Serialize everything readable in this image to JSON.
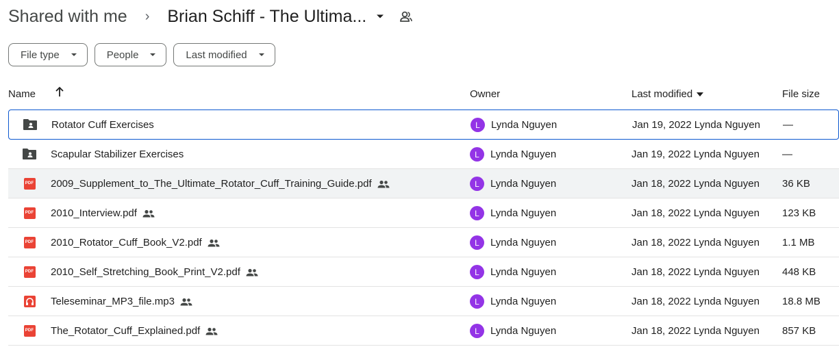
{
  "breadcrumb": {
    "root": "Shared with me",
    "separator": "›",
    "current": "Brian Schiff - The Ultima..."
  },
  "filters": [
    {
      "label": "File type"
    },
    {
      "label": "People"
    },
    {
      "label": "Last modified"
    }
  ],
  "columns": {
    "name": "Name",
    "owner": "Owner",
    "last_modified": "Last modified",
    "file_size": "File size"
  },
  "colors": {
    "accent": "#0b57d0",
    "avatar": "#9334e6",
    "pdf": "#ea4335",
    "audio": "#ea4335",
    "folder": "#444746"
  },
  "files": [
    {
      "icon": "shared-folder-icon",
      "name": "Rotator Cuff Exercises",
      "shared": false,
      "owner_initial": "L",
      "owner": "Lynda Nguyen",
      "modified_date": "Jan 19, 2022",
      "modified_by": "Lynda Nguyen",
      "size": "—"
    },
    {
      "icon": "shared-folder-icon",
      "name": "Scapular Stabilizer Exercises",
      "shared": false,
      "owner_initial": "L",
      "owner": "Lynda Nguyen",
      "modified_date": "Jan 19, 2022",
      "modified_by": "Lynda Nguyen",
      "size": "—"
    },
    {
      "icon": "pdf-icon",
      "pdf_label": "PDF",
      "name": "2009_Supplement_to_The_Ultimate_Rotator_Cuff_Training_Guide.pdf",
      "shared": true,
      "owner_initial": "L",
      "owner": "Lynda Nguyen",
      "modified_date": "Jan 18, 2022",
      "modified_by": "Lynda Nguyen",
      "size": "36 KB"
    },
    {
      "icon": "pdf-icon",
      "pdf_label": "PDF",
      "name": "2010_Interview.pdf",
      "shared": true,
      "owner_initial": "L",
      "owner": "Lynda Nguyen",
      "modified_date": "Jan 18, 2022",
      "modified_by": "Lynda Nguyen",
      "size": "123 KB"
    },
    {
      "icon": "pdf-icon",
      "pdf_label": "PDF",
      "name": "2010_Rotator_Cuff_Book_V2.pdf",
      "shared": true,
      "owner_initial": "L",
      "owner": "Lynda Nguyen",
      "modified_date": "Jan 18, 2022",
      "modified_by": "Lynda Nguyen",
      "size": "1.1 MB"
    },
    {
      "icon": "pdf-icon",
      "pdf_label": "PDF",
      "name": "2010_Self_Stretching_Book_Print_V2.pdf",
      "shared": true,
      "owner_initial": "L",
      "owner": "Lynda Nguyen",
      "modified_date": "Jan 18, 2022",
      "modified_by": "Lynda Nguyen",
      "size": "448 KB"
    },
    {
      "icon": "audio-file-icon",
      "name": "Teleseminar_MP3_file.mp3",
      "shared": true,
      "owner_initial": "L",
      "owner": "Lynda Nguyen",
      "modified_date": "Jan 18, 2022",
      "modified_by": "Lynda Nguyen",
      "size": "18.8 MB"
    },
    {
      "icon": "pdf-icon",
      "pdf_label": "PDF",
      "name": "The_Rotator_Cuff_Explained.pdf",
      "shared": true,
      "owner_initial": "L",
      "owner": "Lynda Nguyen",
      "modified_date": "Jan 18, 2022",
      "modified_by": "Lynda Nguyen",
      "size": "857 KB"
    }
  ]
}
